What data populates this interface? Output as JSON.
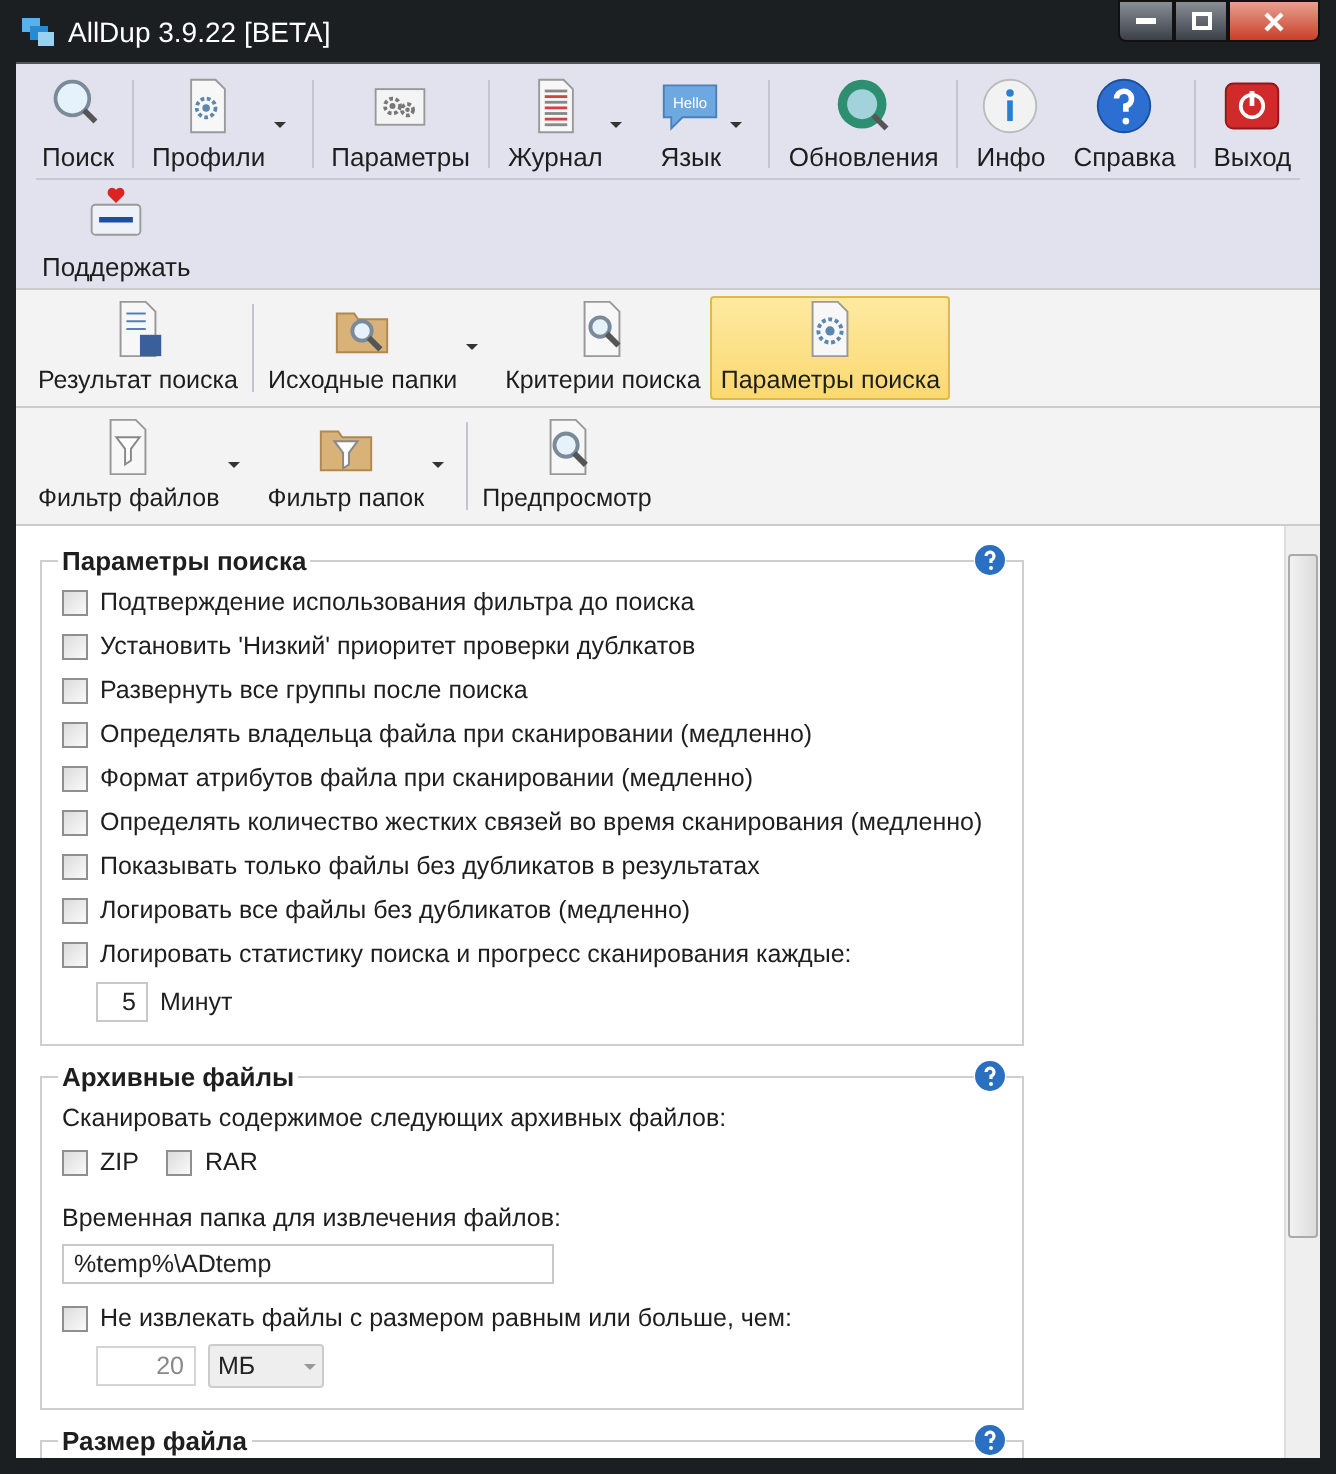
{
  "window": {
    "title": "AllDup 3.9.22 [BETA]"
  },
  "main_toolbar": [
    [
      {
        "label": "Поиск",
        "has_menu": false
      },
      {
        "label": "Профили",
        "has_menu": true
      },
      {
        "label": "Параметры",
        "has_menu": false
      },
      {
        "label": "Журнал",
        "has_menu": true
      },
      {
        "label": "Язык",
        "has_menu": true,
        "icon_text": "Hello"
      },
      {
        "label": "Обновления",
        "has_menu": false
      },
      {
        "label": "Инфо",
        "has_menu": false
      },
      {
        "label": "Справка",
        "has_menu": false
      },
      {
        "label": "Выход",
        "has_menu": false
      }
    ],
    [
      {
        "label": "Поддержать",
        "has_menu": false
      }
    ]
  ],
  "view_tabs": [
    {
      "label": "Результат поиска",
      "selected": false,
      "has_menu": false
    },
    {
      "label": "Исходные папки",
      "selected": false,
      "has_menu": true
    },
    {
      "label": "Критерии поиска",
      "selected": false,
      "has_menu": false
    },
    {
      "label": "Параметры поиска",
      "selected": true,
      "has_menu": false
    }
  ],
  "sub_toolbar": [
    {
      "label": "Фильтр файлов",
      "has_menu": true
    },
    {
      "label": "Фильтр папок",
      "has_menu": true
    },
    {
      "label": "Предпросмотр",
      "has_menu": false
    }
  ],
  "search_options": {
    "title": "Параметры поиска",
    "options": [
      {
        "label": "Подтверждение использования фильтра до поиска",
        "checked": false
      },
      {
        "label": "Установить 'Низкий' приоритет проверки дублкатов",
        "checked": false
      },
      {
        "label": "Развернуть все группы после поиска",
        "checked": false
      },
      {
        "label": "Определять владельца файла при сканировании (медленно)",
        "checked": false
      },
      {
        "label": "Формат атрибутов файла при сканировании (медленно)",
        "checked": false
      },
      {
        "label": "Определять количество жестких связей во время сканирования (медленно)",
        "checked": false
      },
      {
        "label": "Показывать только файлы без дубликатов в результатах",
        "checked": false
      },
      {
        "label": "Логировать все файлы без дубликатов (медленно)",
        "checked": false
      },
      {
        "label": "Логировать статистику поиска и прогресс сканирования каждые:",
        "checked": false
      }
    ],
    "interval": {
      "value": "5",
      "unit": "Минут"
    }
  },
  "archives": {
    "title": "Архивные файлы",
    "prompt": "Сканировать содержимое следующих архивных файлов:",
    "formats": [
      {
        "label": "ZIP",
        "checked": false
      },
      {
        "label": "RAR",
        "checked": false
      }
    ],
    "temp_folder_label": "Временная папка для извлечения файлов:",
    "temp_folder": "%temp%\\ADtemp",
    "size_limit": {
      "label": "Не извлекать файлы с размером равным или больше, чем:",
      "checked": false,
      "value": "20",
      "unit": "МБ",
      "disabled": true
    }
  },
  "file_size": {
    "title": "Размер файла"
  }
}
